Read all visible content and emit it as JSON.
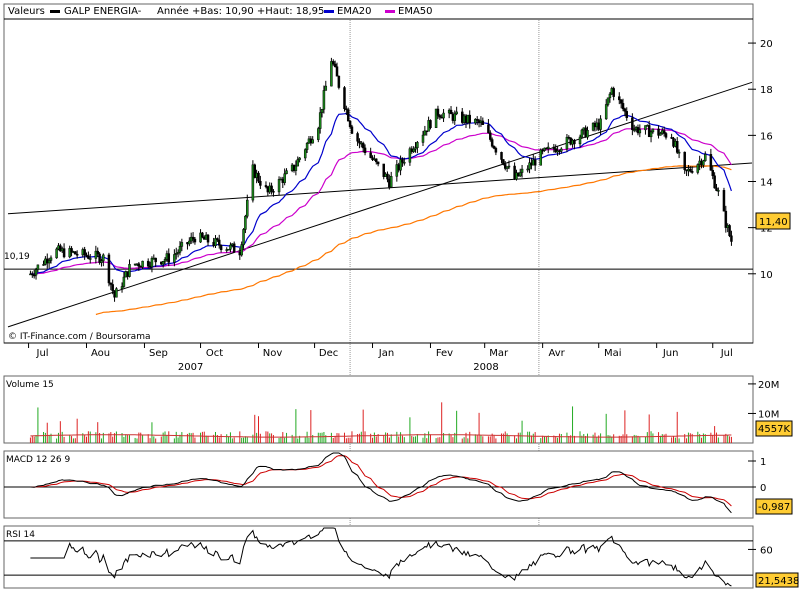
{
  "header": {
    "menu_label": "Valeurs",
    "series_name": "GALP ENERGIA-",
    "range_text": "Année +Bas: 10,90 +Haut: 18,95",
    "ema20_label": "EMA20",
    "ema50_label": "EMA50",
    "colors": {
      "price": "#000000",
      "ema20": "#0000cc",
      "ema50": "#cc00cc",
      "ema200": "#ff7700"
    }
  },
  "footer": {
    "credit": "© IT-Finance.com / Boursorama"
  },
  "chart_data": [
    {
      "type": "candlestick",
      "name": "GALP ENERGIA-",
      "ylim": [
        7,
        21
      ],
      "y_ticks": [
        "10",
        "12",
        "14",
        "16",
        "18",
        "20"
      ],
      "x_month_labels": [
        "Jul",
        "Aou",
        "Sep",
        "Oct",
        "Nov",
        "Dec",
        "Jan",
        "Fev",
        "Mar",
        "Avr",
        "Mai",
        "Jun",
        "Jul"
      ],
      "x_year_labels": [
        "2007",
        "2008"
      ],
      "start_value_label": "10,19",
      "last_value_label": "11,40",
      "low": 10.9,
      "high": 18.95,
      "reference_line": 10.2,
      "close_anchors": [
        [
          "2007-07-02",
          10.0
        ],
        [
          "2007-07-15",
          11.0
        ],
        [
          "2007-08-10",
          10.7
        ],
        [
          "2007-08-16",
          9.0
        ],
        [
          "2007-08-25",
          10.4
        ],
        [
          "2007-09-15",
          10.7
        ],
        [
          "2007-09-28",
          11.6
        ],
        [
          "2007-10-22",
          11.0
        ],
        [
          "2007-10-25",
          12.5
        ],
        [
          "2007-10-29",
          14.5
        ],
        [
          "2007-11-06",
          13.5
        ],
        [
          "2007-11-20",
          14.6
        ],
        [
          "2007-12-03",
          16.5
        ],
        [
          "2007-12-10",
          19.3
        ],
        [
          "2007-12-22",
          16.0
        ],
        [
          "2008-01-10",
          14.0
        ],
        [
          "2008-01-22",
          15.5
        ],
        [
          "2008-02-05",
          17.0
        ],
        [
          "2008-02-28",
          16.5
        ],
        [
          "2008-03-17",
          14.1
        ],
        [
          "2008-04-01",
          15.2
        ],
        [
          "2008-04-21",
          16.0
        ],
        [
          "2008-05-02",
          16.5
        ],
        [
          "2008-05-08",
          18.0
        ],
        [
          "2008-05-20",
          16.3
        ],
        [
          "2008-06-09",
          16.0
        ],
        [
          "2008-06-16",
          14.3
        ],
        [
          "2008-06-27",
          15.1
        ],
        [
          "2008-07-04",
          13.5
        ],
        [
          "2008-07-08",
          12.2
        ],
        [
          "2008-07-11",
          11.4
        ]
      ],
      "trendlines": [
        {
          "from": [
            "2007-06-20",
            7.7
          ],
          "to": [
            "2008-07-22",
            18.3
          ]
        },
        {
          "from": [
            "2007-06-20",
            12.6
          ],
          "to": [
            "2008-07-22",
            14.8
          ]
        }
      ]
    },
    {
      "type": "bar",
      "title": "Volume 15",
      "y_tick_labels": [
        "10M",
        "20M"
      ],
      "last_value_label": "4557K"
    },
    {
      "type": "line",
      "title": "MACD 12 26 9",
      "y_tick_labels": [
        "1",
        "0"
      ],
      "last_value_label": "-0,987"
    },
    {
      "type": "line",
      "title": "RSI 14",
      "y_tick_labels": [
        "60"
      ],
      "upper_band": 70,
      "lower_band": 30,
      "last_value_label": "21,5438"
    }
  ]
}
